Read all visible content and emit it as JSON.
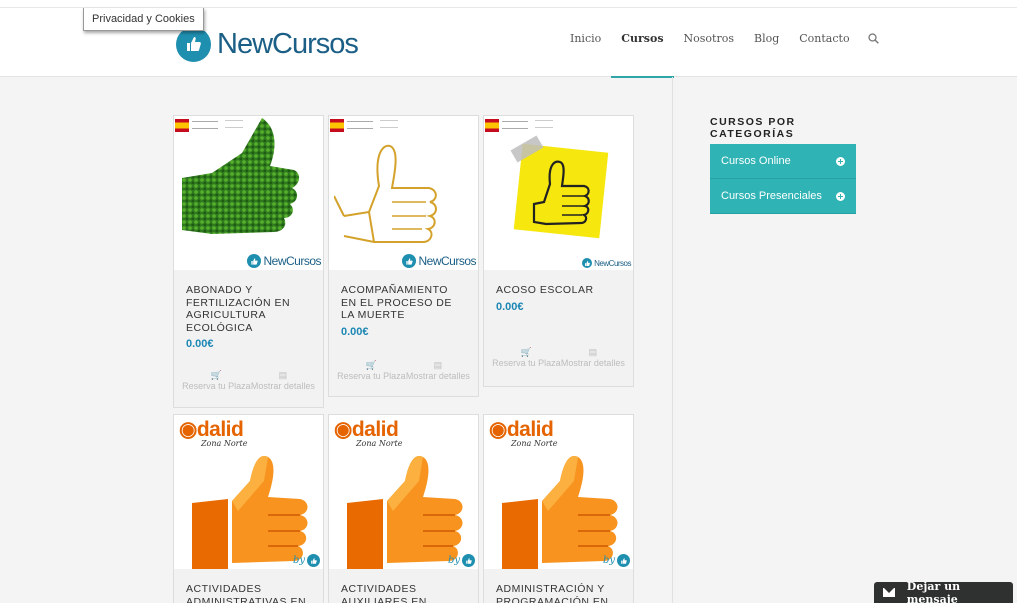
{
  "cookie": {
    "label": "Privacidad y Cookies"
  },
  "logo": {
    "text": "NewCursos"
  },
  "nav": {
    "items": [
      {
        "label": "Inicio",
        "active": false
      },
      {
        "label": "Cursos",
        "active": true
      },
      {
        "label": "Nosotros",
        "active": false
      },
      {
        "label": "Blog",
        "active": false
      },
      {
        "label": "Contacto",
        "active": false
      }
    ],
    "search_icon": "search-icon"
  },
  "sidebar": {
    "title": "CURSOS POR CATEGORÍAS",
    "categories": [
      {
        "label": "Cursos Online"
      },
      {
        "label": "Cursos Presenciales"
      }
    ],
    "accent": "#2fb3b4"
  },
  "courses": [
    {
      "title": "Abonado y fertilización en agricultura ecológica",
      "price": "0.00€",
      "reserve": "Reserva tu Plaza",
      "details": "Mostrar detalles",
      "brand": "NewCursos"
    },
    {
      "title": "Acompañamiento en el proceso de la muerte",
      "price": "0.00€",
      "reserve": "Reserva tu Plaza",
      "details": "Mostrar detalles",
      "brand": "NewCursos"
    },
    {
      "title": "Acoso escolar",
      "price": "0.00€",
      "reserve": "Reserva tu Plaza",
      "details": "Mostrar detalles",
      "brand": "NewCursos"
    },
    {
      "title": "Actividades administrativas en",
      "brand": "dalid",
      "brand_sub": "Zona Norte",
      "by": "by"
    },
    {
      "title": "Actividades auxiliares en",
      "brand": "dalid",
      "brand_sub": "Zona Norte",
      "by": "by"
    },
    {
      "title": "Administración y programación en",
      "brand": "dalid",
      "brand_sub": "Zona Norte",
      "by": "by"
    }
  ],
  "chat": {
    "label": "Dejar un mensaje"
  },
  "colors": {
    "link_blue": "#1c87b4",
    "brand_blue": "#1f8fb0",
    "teal": "#2fb3b4",
    "adalid_orange": "#e56400"
  }
}
